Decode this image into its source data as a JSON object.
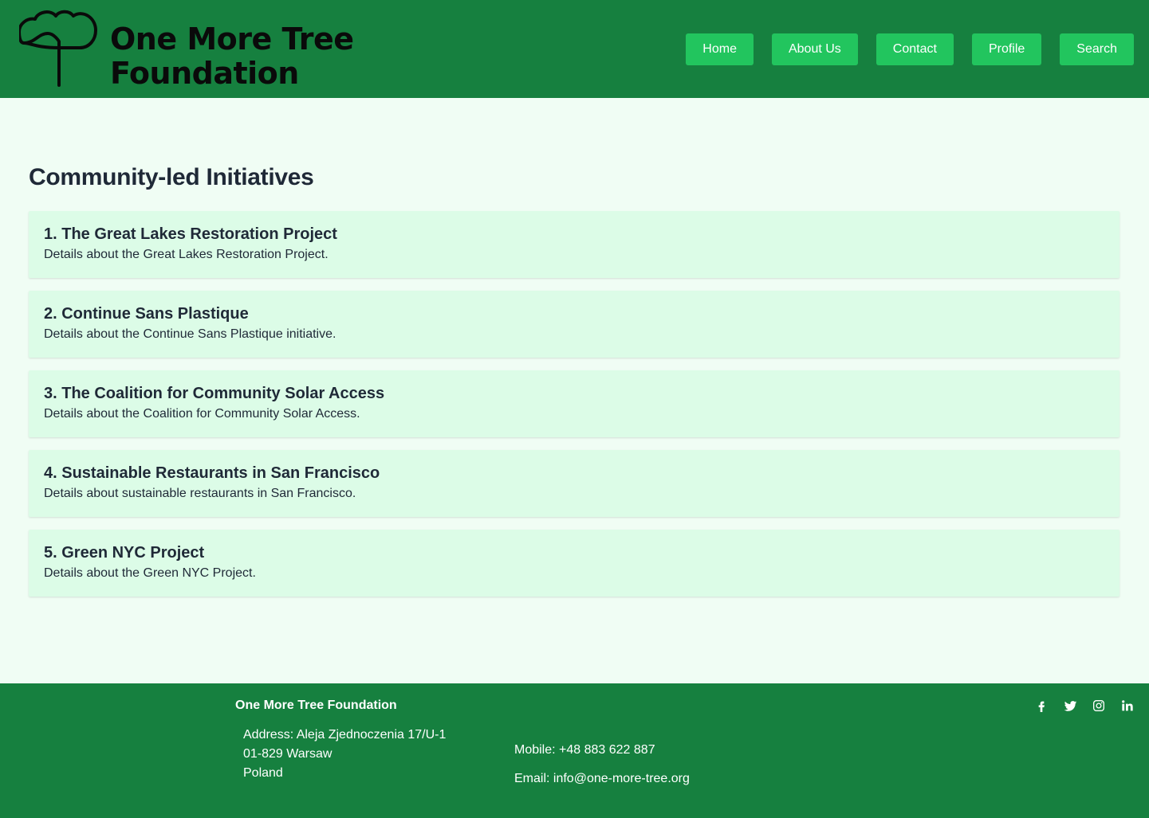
{
  "header": {
    "logo_line1": "One More Tree",
    "logo_line2": "Foundation",
    "logo_icon": "tree-icon",
    "nav": [
      "Home",
      "About Us",
      "Contact",
      "Profile",
      "Search"
    ]
  },
  "main": {
    "title": "Community-led Initiatives",
    "initiatives": [
      {
        "title": "1. The Great Lakes Restoration Project",
        "desc": "Details about the Great Lakes Restoration Project."
      },
      {
        "title": "2. Continue Sans Plastique",
        "desc": "Details about the Continue Sans Plastique initiative."
      },
      {
        "title": "3. The Coalition for Community Solar Access",
        "desc": "Details about the Coalition for Community Solar Access."
      },
      {
        "title": "4. Sustainable Restaurants in San Francisco",
        "desc": "Details about sustainable restaurants in San Francisco."
      },
      {
        "title": "5. Green NYC Project",
        "desc": "Details about the Green NYC Project."
      }
    ]
  },
  "footer": {
    "org": "One More Tree Foundation",
    "address": [
      "Address: Aleja Zjednoczenia 17/U-1",
      "01-829 Warsaw",
      "Poland"
    ],
    "mobile": "Mobile: +48 883 622 887",
    "email": "Email: info@one-more-tree.org",
    "social_icons": [
      "facebook-icon",
      "twitter-icon",
      "instagram-icon",
      "linkedin-icon"
    ]
  },
  "colors": {
    "header_bg": "#16803f",
    "nav_button": "#22c55e",
    "page_bg": "#f0fdf4",
    "card_bg": "#dcfce7",
    "text": "#1f2937"
  }
}
